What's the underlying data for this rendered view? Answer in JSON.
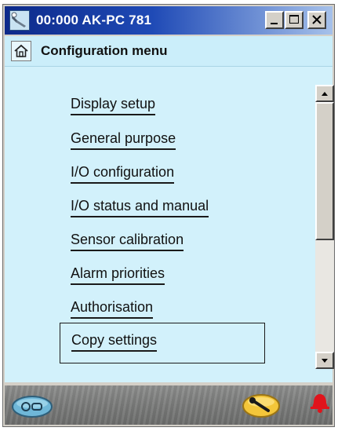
{
  "window": {
    "title": "00:000 AK-PC 781",
    "controls": [
      "minimize",
      "maximize",
      "close"
    ]
  },
  "header": {
    "title": "Configuration menu",
    "home_icon": "home-icon"
  },
  "menu": {
    "items": [
      {
        "label": "Display setup"
      },
      {
        "label": "General purpose"
      },
      {
        "label": "I/O configuration"
      },
      {
        "label": "I/O status and manual"
      },
      {
        "label": "Sensor calibration"
      },
      {
        "label": "Alarm priorities"
      },
      {
        "label": "Authorisation"
      },
      {
        "label": "Copy settings",
        "selected": true
      }
    ]
  },
  "statusbar": {
    "icons": [
      "controller-status-icon",
      "wrench-icon",
      "alarm-bell-icon"
    ]
  },
  "colors": {
    "content_bg": "#d2f1fb",
    "titlebar": "#1f4ab6",
    "alarm": "#e0141c",
    "wrench_badge": "#f4c63a"
  }
}
